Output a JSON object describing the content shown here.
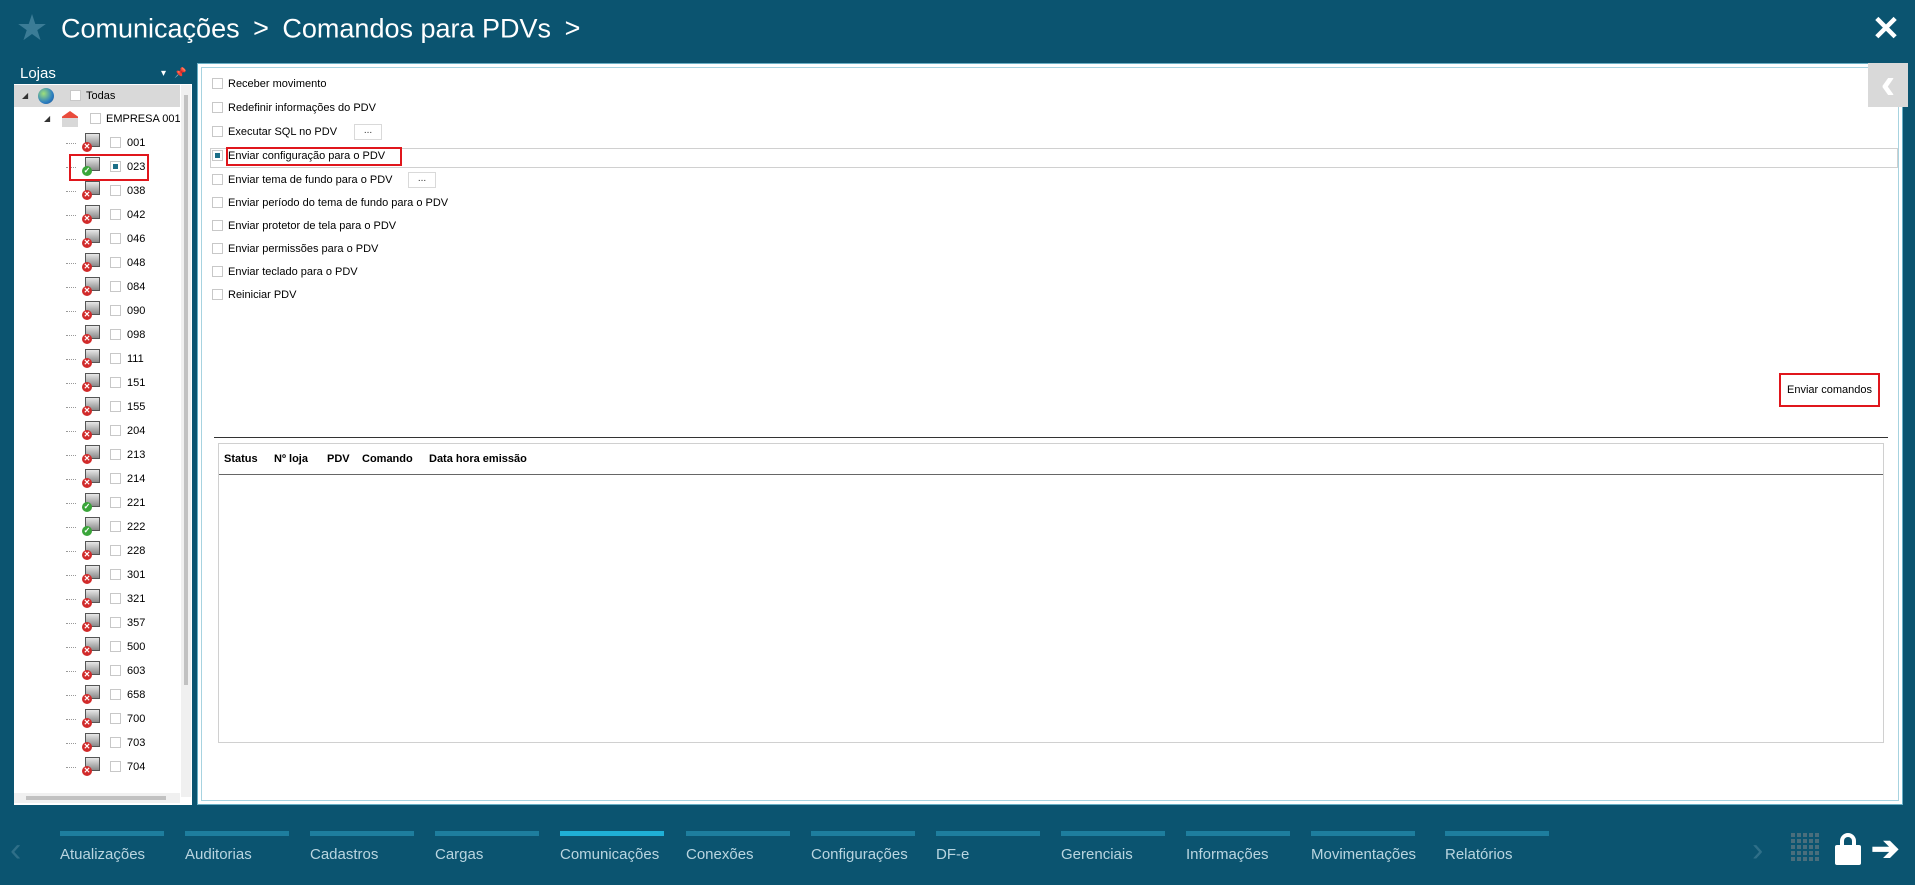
{
  "header": {
    "breadcrumb": [
      "Comunicações",
      "Comandos para PDVs"
    ],
    "separator": ">",
    "close_glyph": "✕",
    "icons": {
      "home": "star-icon",
      "close": "close-icon"
    }
  },
  "left_panel": {
    "title": "Lojas",
    "pin_glyph": "📌",
    "dropdown_glyph": "▾",
    "root": {
      "label": "Todas",
      "checked": false,
      "icon": "globe-icon"
    },
    "company": {
      "label": "EMPRESA 001",
      "checked": false,
      "icon": "company-icon"
    },
    "stores": [
      {
        "code": "001",
        "online": false,
        "checked": false
      },
      {
        "code": "023",
        "online": true,
        "checked": true
      },
      {
        "code": "038",
        "online": false,
        "checked": false
      },
      {
        "code": "042",
        "online": false,
        "checked": false
      },
      {
        "code": "046",
        "online": false,
        "checked": false
      },
      {
        "code": "048",
        "online": false,
        "checked": false
      },
      {
        "code": "084",
        "online": false,
        "checked": false
      },
      {
        "code": "090",
        "online": false,
        "checked": false
      },
      {
        "code": "098",
        "online": false,
        "checked": false
      },
      {
        "code": "111",
        "online": false,
        "checked": false
      },
      {
        "code": "151",
        "online": false,
        "checked": false
      },
      {
        "code": "155",
        "online": false,
        "checked": false
      },
      {
        "code": "204",
        "online": false,
        "checked": false
      },
      {
        "code": "213",
        "online": false,
        "checked": false
      },
      {
        "code": "214",
        "online": false,
        "checked": false
      },
      {
        "code": "221",
        "online": true,
        "checked": false
      },
      {
        "code": "222",
        "online": true,
        "checked": false
      },
      {
        "code": "228",
        "online": false,
        "checked": false
      },
      {
        "code": "301",
        "online": false,
        "checked": false
      },
      {
        "code": "321",
        "online": false,
        "checked": false
      },
      {
        "code": "357",
        "online": false,
        "checked": false
      },
      {
        "code": "500",
        "online": false,
        "checked": false
      },
      {
        "code": "603",
        "online": false,
        "checked": false
      },
      {
        "code": "658",
        "online": false,
        "checked": false
      },
      {
        "code": "700",
        "online": false,
        "checked": false
      },
      {
        "code": "703",
        "online": false,
        "checked": false
      },
      {
        "code": "704",
        "online": false,
        "checked": false
      }
    ]
  },
  "commands": {
    "options": [
      {
        "label": "Receber movimento",
        "checked": false
      },
      {
        "label": "Redefinir informações do PDV",
        "checked": false
      },
      {
        "label": "Executar SQL no PDV",
        "checked": false,
        "has_button": true
      },
      {
        "label": "Enviar configuração para o PDV",
        "checked": true
      },
      {
        "label": "Enviar tema de fundo para o PDV",
        "checked": false,
        "has_button": true
      },
      {
        "label": "Enviar período do tema de fundo para o PDV",
        "checked": false
      },
      {
        "label": "Enviar protetor de tela para o PDV",
        "checked": false
      },
      {
        "label": "Enviar permissões para o PDV",
        "checked": false
      },
      {
        "label": "Enviar teclado para o PDV",
        "checked": false
      },
      {
        "label": "Reiniciar PDV",
        "checked": false
      }
    ],
    "ellipsis_label": "...",
    "send_button": "Enviar comandos"
  },
  "results_grid": {
    "columns": [
      "Status",
      "Nº loja",
      "PDV",
      "Comando",
      "Data hora emissão"
    ],
    "rows": []
  },
  "bottom_nav": {
    "tabs": [
      {
        "label": "Atualizações",
        "active": false
      },
      {
        "label": "Auditorias",
        "active": false
      },
      {
        "label": "Cadastros",
        "active": false
      },
      {
        "label": "Cargas",
        "active": false
      },
      {
        "label": "Comunicações",
        "active": true
      },
      {
        "label": "Conexões",
        "active": false
      },
      {
        "label": "Configurações",
        "active": false
      },
      {
        "label": "DF-e",
        "active": false
      },
      {
        "label": "Gerenciais",
        "active": false
      },
      {
        "label": "Informações",
        "active": false
      },
      {
        "label": "Movimentações",
        "active": false
      },
      {
        "label": "Relatórios",
        "active": false
      }
    ],
    "icons": [
      "chevron-left-icon",
      "chevron-right-icon",
      "apps-grid-icon",
      "lock-icon",
      "exit-arrow-icon"
    ]
  },
  "colors": {
    "chrome": "#0b5470",
    "tab_bar": "#1e7e9e",
    "tab_bar_active": "#1fb0d6",
    "highlight": "#e0161c",
    "check_fill": "#1c6f88"
  }
}
